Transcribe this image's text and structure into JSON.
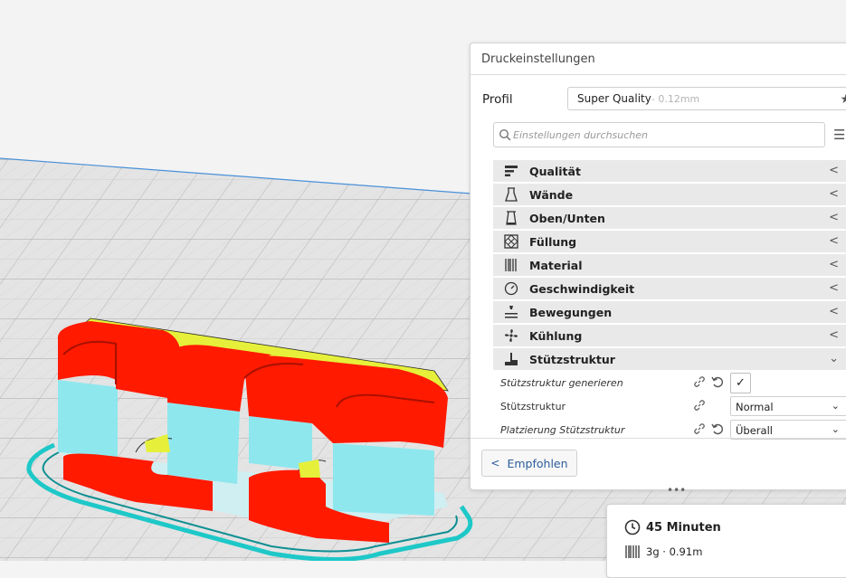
{
  "panel": {
    "title": "Druckeinstellungen",
    "profile_label": "Profil",
    "profile_name": "Super Quality",
    "profile_layer": " - 0.12mm",
    "search_placeholder": "Einstellungen durchsuchen"
  },
  "categories": [
    {
      "label": "Qualität",
      "icon": "quality-icon",
      "expanded": false
    },
    {
      "label": "Wände",
      "icon": "walls-icon",
      "expanded": false
    },
    {
      "label": "Oben/Unten",
      "icon": "top-bottom-icon",
      "expanded": false
    },
    {
      "label": "Füllung",
      "icon": "infill-icon",
      "expanded": false
    },
    {
      "label": "Material",
      "icon": "material-icon",
      "expanded": false
    },
    {
      "label": "Geschwindigkeit",
      "icon": "speed-icon",
      "expanded": false
    },
    {
      "label": "Bewegungen",
      "icon": "travel-icon",
      "expanded": false
    },
    {
      "label": "Kühlung",
      "icon": "cooling-icon",
      "expanded": false
    },
    {
      "label": "Stützstruktur",
      "icon": "support-icon",
      "expanded": true
    }
  ],
  "settings": {
    "generate_support_label": "Stützstruktur generieren",
    "generate_support_checked": true,
    "support_structure_label": "Stützstruktur",
    "support_structure_value": "Normal",
    "support_placement_label": "Platzierung Stützstruktur",
    "support_placement_value": "Überall"
  },
  "footer": {
    "recommended_label": "Empfohlen"
  },
  "estimate": {
    "time": "45 Minuten",
    "material": "3g · 0.91m"
  },
  "colors": {
    "model_red": "#ff1a00",
    "support_cyan": "#8fe7ee",
    "infill_yellow": "#e6f03a",
    "skirt_teal": "#1ec8c8",
    "accent_blue": "#2b5d9a"
  }
}
